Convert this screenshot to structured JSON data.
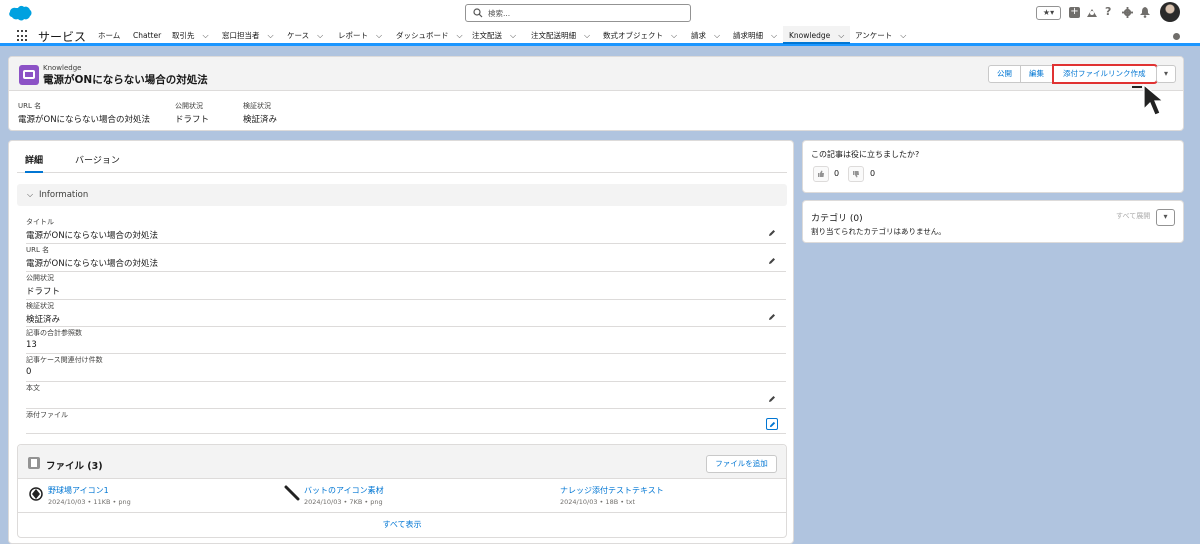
{
  "header": {
    "search_placeholder": "検索...",
    "favorites_glyph": "★▾",
    "help_glyph": "?"
  },
  "nav": {
    "app_name": "サービス",
    "items": [
      {
        "label": "ホーム",
        "dropdown": false
      },
      {
        "label": "Chatter",
        "dropdown": false
      },
      {
        "label": "取引先",
        "dropdown": true
      },
      {
        "label": "窓口担当者",
        "dropdown": true
      },
      {
        "label": "ケース",
        "dropdown": true
      },
      {
        "label": "レポート",
        "dropdown": true
      },
      {
        "label": "ダッシュボード",
        "dropdown": true
      },
      {
        "label": "注文配送",
        "dropdown": true
      },
      {
        "label": "注文配送明細",
        "dropdown": true
      },
      {
        "label": "数式オブジェクト",
        "dropdown": true
      },
      {
        "label": "請求",
        "dropdown": true
      },
      {
        "label": "請求明細",
        "dropdown": true
      },
      {
        "label": "Knowledge",
        "dropdown": true,
        "active": true
      },
      {
        "label": "アンケート",
        "dropdown": true
      }
    ]
  },
  "record": {
    "object_label": "Knowledge",
    "title": "電源がONにならない場合の対処法",
    "buttons": {
      "publish": "公開",
      "edit": "編集",
      "create_link": "添付ファイルリンク作成"
    },
    "highlights": [
      {
        "label": "URL 名",
        "value": "電源がONにならない場合の対処法"
      },
      {
        "label": "公開状況",
        "value": "ドラフト"
      },
      {
        "label": "検証状況",
        "value": "検証済み"
      }
    ]
  },
  "detail": {
    "tabs": [
      "詳細",
      "バージョン"
    ],
    "section_title": "Information",
    "fields": [
      {
        "label": "タイトル",
        "value": "電源がONにならない場合の対処法"
      },
      {
        "label": "URL 名",
        "value": "電源がONにならない場合の対処法"
      },
      {
        "label": "公開状況",
        "value": "ドラフト"
      },
      {
        "label": "検証状況",
        "value": "検証済み"
      },
      {
        "label": "記事の合計参照数",
        "value": "13"
      },
      {
        "label": "記事ケース関連付け件数",
        "value": "0"
      },
      {
        "label": "本文",
        "value": ""
      },
      {
        "label": "添付ファイル",
        "value": ""
      }
    ]
  },
  "files": {
    "title": "ファイル (3)",
    "add_button": "ファイルを追加",
    "items": [
      {
        "name": "野球場アイコン1",
        "meta": "2024/10/03 • 11KB • png",
        "icon": "baseball-field-icon"
      },
      {
        "name": "バットのアイコン素材",
        "meta": "2024/10/03 • 7KB • png",
        "icon": "baseball-bat-icon"
      },
      {
        "name": "ナレッジ添付テストテキスト",
        "meta": "2024/10/03 • 18B • txt",
        "icon": "text-file-icon"
      }
    ],
    "show_all": "すべて表示"
  },
  "feedback": {
    "question": "この記事は役に立ちましたか?",
    "up_count": "0",
    "down_count": "0"
  },
  "category": {
    "title": "カテゴリ (0)",
    "empty": "割り当てられたカテゴリはありません。",
    "show_all": "すべて展開"
  }
}
